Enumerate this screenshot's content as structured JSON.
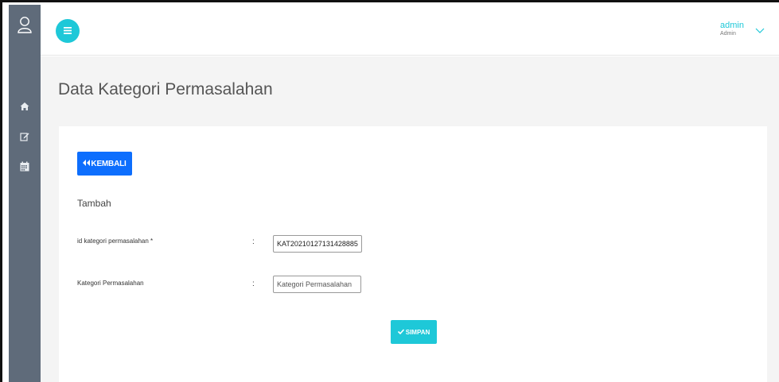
{
  "topbar": {
    "user_name": "admin",
    "user_role": "Admin"
  },
  "page": {
    "title": "Data Kategori Permasalahan"
  },
  "form": {
    "back_label": "KEMBALI",
    "section_title": "Tambah",
    "id_label": "id kategori permasalahan *",
    "id_value": "KAT20210127131428885",
    "category_label": "Kategori Permasalahan",
    "category_placeholder": "Kategori Permasalahan",
    "category_value": "",
    "colon": ":",
    "save_label": "SIMPAN"
  },
  "sidebar": {
    "items": [
      "home-icon",
      "edit-icon",
      "calendar-icon"
    ]
  },
  "colors": {
    "sidebar": "#5f6b7a",
    "accent": "#1ec8d8",
    "primary_button": "#0d6efd"
  }
}
